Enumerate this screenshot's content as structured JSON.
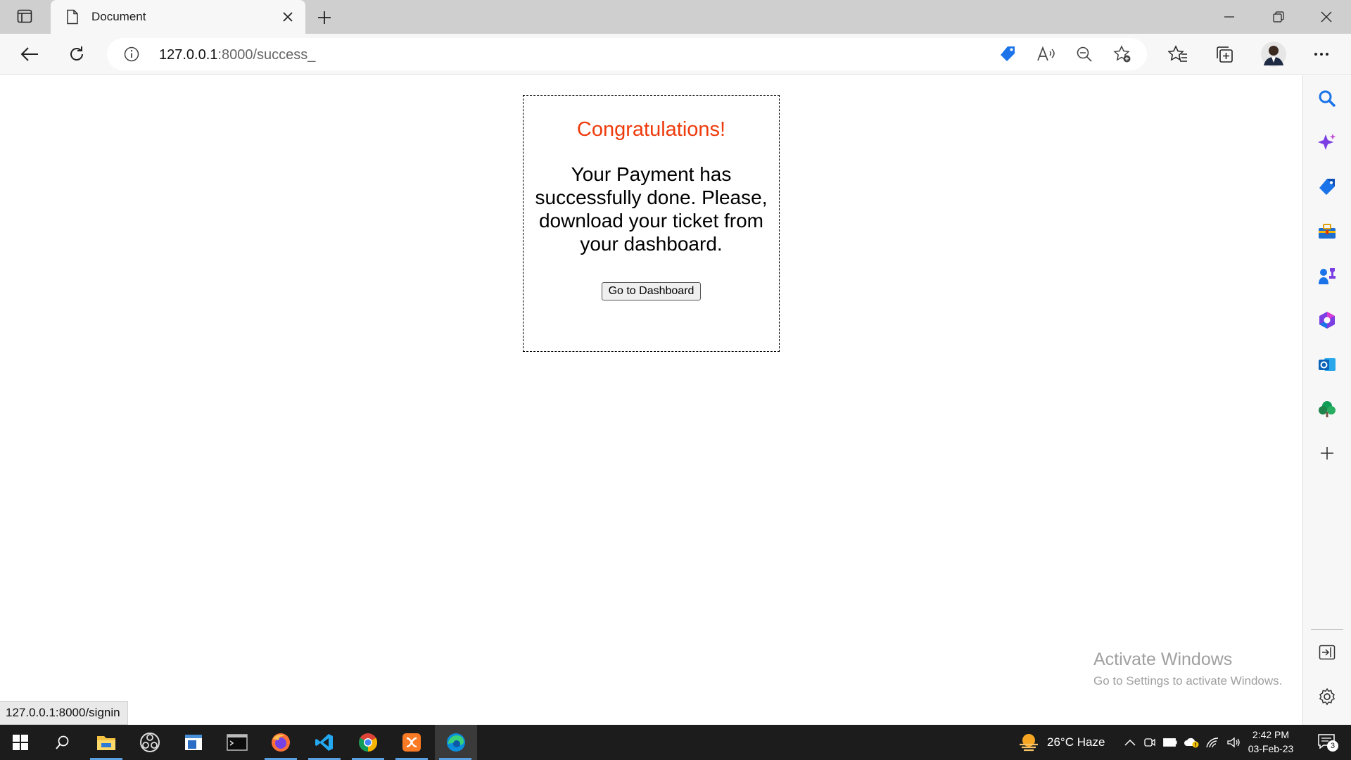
{
  "browser": {
    "tab": {
      "title": "Document"
    },
    "address": {
      "host": "127.0.0.1",
      "path": ":8000/success_"
    }
  },
  "page": {
    "heading": "Congratulations!",
    "message": "Your Payment has successfully done. Please, download your ticket from your dashboard.",
    "button_label": "Go to Dashboard"
  },
  "status_bar": {
    "hover_url": "127.0.0.1:8000/signin"
  },
  "watermark": {
    "title": "Activate Windows",
    "subtitle": "Go to Settings to activate Windows."
  },
  "sidebar": {
    "items": [
      "search-icon",
      "copilot-icon",
      "shopping-icon",
      "tools-icon",
      "games-icon",
      "office-icon",
      "outlook-icon",
      "drop-icon",
      "add-icon"
    ],
    "bottom": [
      "exit-pane-icon",
      "settings-icon"
    ]
  },
  "taskbar": {
    "apps": [
      "start-icon",
      "search-icon",
      "file-explorer-icon",
      "obs-icon",
      "notepad-icon",
      "terminal-icon",
      "firefox-icon",
      "vscode-icon",
      "chrome-icon",
      "xampp-icon",
      "edge-icon"
    ],
    "weather": "26°C  Haze",
    "time": "2:42 PM",
    "date": "03-Feb-23",
    "notification_count": "3"
  },
  "colors": {
    "heading": "#ee3b0c",
    "accent": "#1a73e8",
    "taskbar": "#1c1c1c"
  }
}
